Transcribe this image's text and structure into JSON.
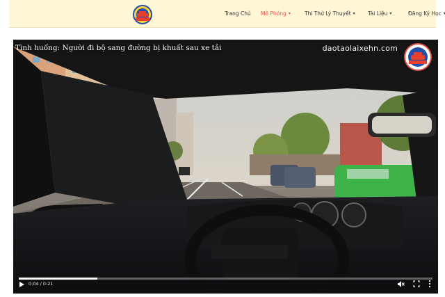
{
  "nav": {
    "items": [
      {
        "label": "Trang Chủ",
        "has_caret": false,
        "active": false
      },
      {
        "label": "Mô Phỏng",
        "has_caret": true,
        "active": true
      },
      {
        "label": "Thi Thử Lý Thuyết",
        "has_caret": true,
        "active": false
      },
      {
        "label": "Tài Liệu",
        "has_caret": true,
        "active": false
      },
      {
        "label": "Đăng Ký Học",
        "has_caret": true,
        "active": false
      }
    ],
    "active_color": "#e0534a",
    "logo_icon": "driving-school-logo-icon"
  },
  "video": {
    "caption": "Tình huống: Người đi bộ sang đường bị khuất sau xe tải",
    "site_watermark": "daotaolaixehn.com",
    "time": "0:04 / 0:21",
    "progress_fraction": 0.19,
    "icons": {
      "play": "play-icon",
      "mute": "volume-muted-icon",
      "fullscreen": "fullscreen-icon",
      "menu": "more-options-icon"
    }
  },
  "colors": {
    "header_bg": "#fff6d6",
    "accent": "#e0534a"
  }
}
